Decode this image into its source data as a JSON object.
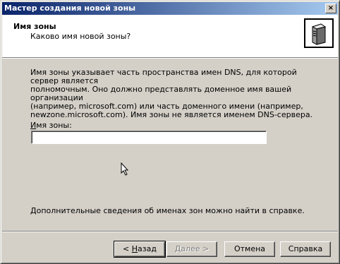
{
  "window": {
    "title": "Мастер создания новой зоны",
    "close_label": "×"
  },
  "header": {
    "title": "Имя зоны",
    "subtitle": "Каково имя новой зоны?",
    "icon": "server-icon"
  },
  "body": {
    "description_lines": [
      "Имя зоны указывает часть пространства имен DNS, для которой сервер является",
      "полномочным. Оно должно представлять доменное имя вашей организации",
      "(например, microsoft.com) или часть доменного имени (например,",
      "newzone.microsoft.com). Имя зоны не является именем DNS-сервера."
    ],
    "zone_name_label_accesskey": "И",
    "zone_name_label_rest": "мя зоны:",
    "zone_name_value": "",
    "more_info": "Дополнительные сведения об именах зон можно найти в справке."
  },
  "buttons": {
    "back_prefix": "< ",
    "back_accesskey": "Н",
    "back_rest": "азад",
    "next_accesskey": "Д",
    "next_rest": "алее >",
    "cancel": "Отмена",
    "help": "Справка"
  },
  "colors": {
    "titlebar_start": "#0a246a",
    "titlebar_end": "#a6caf0",
    "face": "#d4d0c8"
  }
}
